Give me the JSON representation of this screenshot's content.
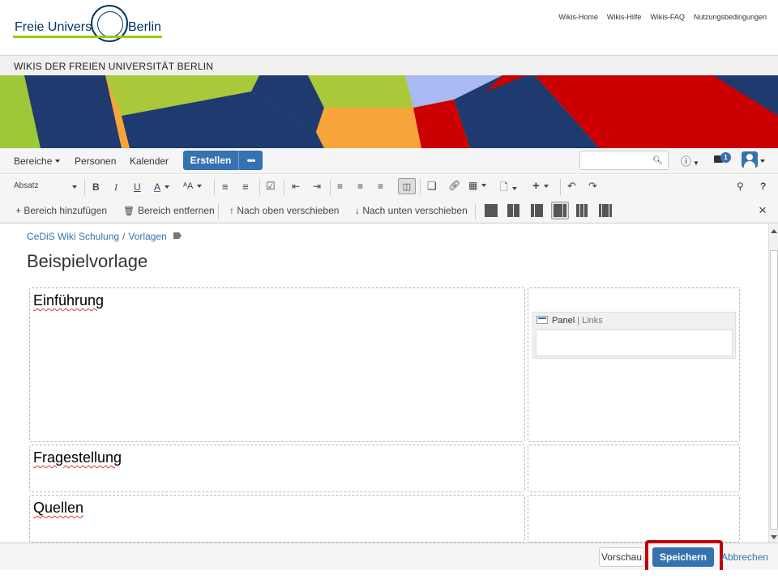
{
  "header": {
    "logo_word_left": "Freie Universität",
    "logo_word_right": "Berlin",
    "links": [
      "Wikis-Home",
      "Wikis-Hilfe",
      "Wikis-FAQ",
      "Nutzungsbedingungen"
    ]
  },
  "wiki_title": "WIKIS DER FREIEN UNIVERSITÄT BERLIN",
  "nav": {
    "spaces": "Bereiche",
    "people": "Personen",
    "calendar": "Kalender",
    "create": "Erstellen",
    "more": "•••",
    "search_placeholder": "",
    "notification_count": "1",
    "help_icon": "help-icon"
  },
  "toolbar": {
    "paragraph_style": "Absatz",
    "bold": "B",
    "italic": "I",
    "underline": "U",
    "text_color": "A",
    "more_format": "ᴬA",
    "add_section": "+ Bereich hinzufügen",
    "remove_section": "Bereich entfernen",
    "move_up": "↑ Nach oben verschieben",
    "move_down": "↓ Nach unten verschieben",
    "close": "×",
    "search": "⚲",
    "help": "?"
  },
  "breadcrumb": [
    "CeDiS Wiki Schulung",
    "Vorlagen"
  ],
  "page_title": "Beispielvorlage",
  "sections": {
    "intro": "Einführung",
    "question": "Fragestellung",
    "sources": "Quellen"
  },
  "panel_macro": {
    "name": "Panel",
    "separator": "|",
    "param": "Links"
  },
  "footer": {
    "preview": "Vorschau",
    "save": "Speichern",
    "cancel": "Abbrechen"
  },
  "colors": {
    "accent_blue": "#3572b0",
    "highlight_red": "#c00000",
    "fu_green": "#99cc00",
    "fu_navy": "#003366"
  }
}
